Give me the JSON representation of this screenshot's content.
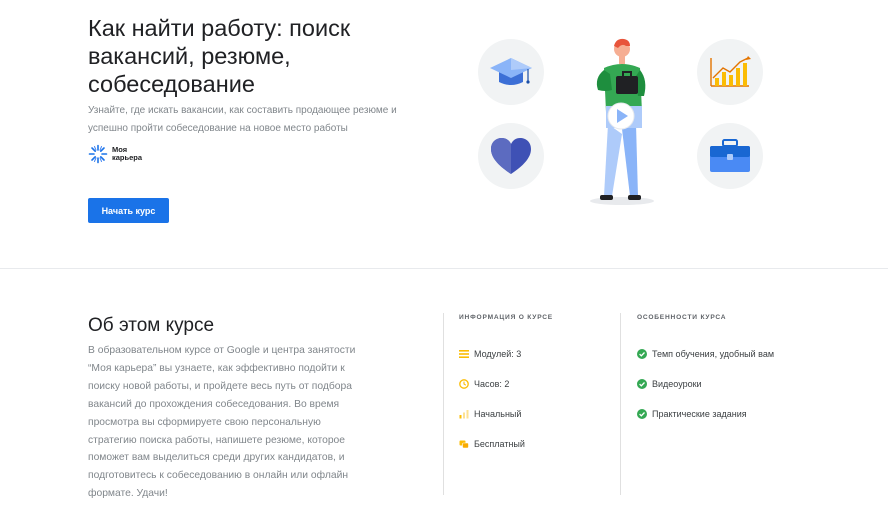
{
  "hero": {
    "title": "Как найти работу: поиск вакансий, резюме, собеседование",
    "description": "Узнайте, где искать вакансии, как составить продающее резюме и успешно пройти собеседование на новое место работы",
    "brand_name": "Моя карьера",
    "start_button": "Начать курс",
    "icons": [
      "graduation-cap-icon",
      "growth-chart-icon",
      "heart-icon",
      "briefcase-icon",
      "play-icon"
    ],
    "accent_color": "#1a73e8"
  },
  "about": {
    "title": "Об этом курсе",
    "text": "В образовательном курсе от Google и центра занятости “Моя карьера” вы узнаете, как эффективно подойти к поиску новой работы, и пройдете весь путь от подбора вакансий до прохождения собеседования. Во время просмотра вы сформируете свою персональную стратегию поиска работы, напишете резюме, которое поможет вам выделиться среди других кандидатов, и подготовитесь к собеседованию в онлайн или офлайн формате. Удачи!"
  },
  "info": {
    "heading": "ИНФОРМАЦИЯ О КУРСЕ",
    "items": [
      {
        "label": "Модулей: 3",
        "icon": "list-icon"
      },
      {
        "label": "Часов: 2",
        "icon": "clock-icon"
      },
      {
        "label": "Начальный",
        "icon": "level-bars-icon"
      },
      {
        "label": "Бесплатный",
        "icon": "coins-icon"
      }
    ]
  },
  "features": {
    "heading": "ОСОБЕННОСТИ КУРСА",
    "items": [
      {
        "label": "Темп обучения, удобный вам",
        "icon": "check-circle-icon"
      },
      {
        "label": "Видеоуроки",
        "icon": "check-circle-icon"
      },
      {
        "label": "Практические задания",
        "icon": "check-circle-icon"
      }
    ],
    "check_color": "#34a853"
  }
}
